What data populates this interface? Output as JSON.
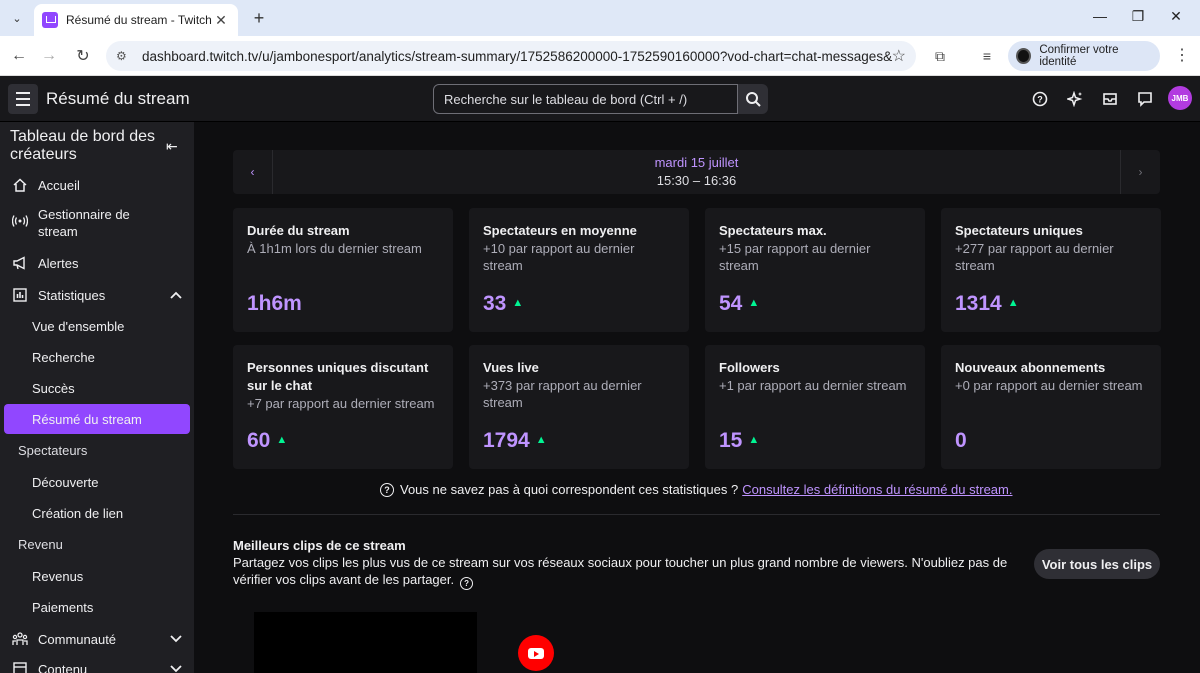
{
  "browser": {
    "tab_title": "Résumé du stream - Twitch",
    "url": "dashboard.twitch.tv/u/jambonesport/analytics/stream-summary/1752586200000-1752590160000?vod-chart=chat-messages&vod-id=...",
    "identity_label": "Confirmer votre identité"
  },
  "header": {
    "title": "Résumé du stream",
    "search_placeholder": "Recherche sur le tableau de bord (Ctrl + /)",
    "avatar_text": "JMB"
  },
  "sidebar": {
    "heading": "Tableau de bord des créateurs",
    "items": [
      {
        "label": "Accueil",
        "icon": "home-icon"
      },
      {
        "label": "Gestionnaire de stream",
        "icon": "broadcast-icon"
      },
      {
        "label": "Alertes",
        "icon": "megaphone-icon"
      },
      {
        "label": "Statistiques",
        "icon": "stats-icon"
      }
    ],
    "stats_sub": [
      "Vue d'ensemble",
      "Recherche",
      "Succès",
      "Résumé du stream"
    ],
    "section_spectateurs": "Spectateurs",
    "spectateurs_sub": [
      "Découverte",
      "Création de lien"
    ],
    "section_revenu": "Revenu",
    "revenu_sub": [
      "Revenus",
      "Paiements"
    ],
    "communaute": "Communauté",
    "contenu": "Contenu"
  },
  "date_nav": {
    "day": "mardi 15 juillet",
    "time": "15:30 – 16:36"
  },
  "stats": [
    {
      "title": "Durée du stream",
      "sub": "À 1h1m lors du dernier stream",
      "value": "1h6m",
      "trend": ""
    },
    {
      "title": "Spectateurs en moyenne",
      "sub": "+10 par rapport au dernier stream",
      "value": "33",
      "trend": "up"
    },
    {
      "title": "Spectateurs max.",
      "sub": "+15 par rapport au dernier stream",
      "value": "54",
      "trend": "up"
    },
    {
      "title": "Spectateurs uniques",
      "sub": "+277 par rapport au dernier stream",
      "value": "1314",
      "trend": "up"
    },
    {
      "title": "Personnes uniques discutant sur le chat",
      "sub": "+7 par rapport au dernier stream",
      "value": "60",
      "trend": "up"
    },
    {
      "title": "Vues live",
      "sub": "+373 par rapport au dernier stream",
      "value": "1794",
      "trend": "up"
    },
    {
      "title": "Followers",
      "sub": "+1 par rapport au dernier stream",
      "value": "15",
      "trend": "up"
    },
    {
      "title": "Nouveaux abonnements",
      "sub": "+0 par rapport au dernier stream",
      "value": "0",
      "trend": ""
    }
  ],
  "help": {
    "question": "Vous ne savez pas à quoi correspondent ces statistiques ?",
    "link": "Consultez les définitions du résumé du stream."
  },
  "clips": {
    "title": "Meilleurs clips de ce stream",
    "description": "Partagez vos clips les plus vus de ce stream sur vos réseaux sociaux pour toucher un plus grand nombre de viewers. N'oubliez pas de vérifier vos clips avant de les partager.",
    "button": "Voir tous les clips"
  },
  "colors": {
    "accent": "#9147ff",
    "value": "#bf94ff",
    "trend_up": "#00f593",
    "background": "#0e0e10",
    "card": "#18181b"
  }
}
